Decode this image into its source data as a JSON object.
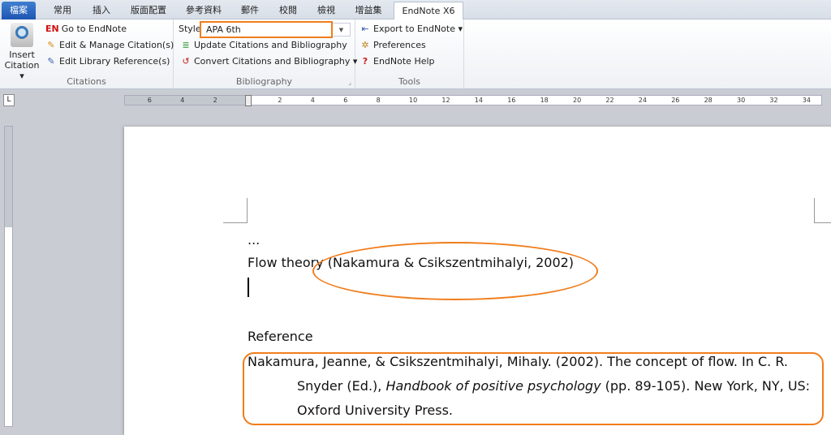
{
  "tabs": [
    "檔案",
    "常用",
    "插入",
    "版面配置",
    "參考資料",
    "郵件",
    "校閱",
    "檢視",
    "增益集",
    "EndNote X6"
  ],
  "ribbon": {
    "citations": {
      "insert_label1": "Insert",
      "insert_label2": "Citation",
      "go": "Go to EndNote",
      "edit_manage": "Edit & Manage Citation(s)",
      "edit_library": "Edit Library Reference(s)",
      "group": "Citations"
    },
    "bibliography": {
      "style_label": "Style:",
      "style_value": "APA 6th",
      "update": "Update Citations and Bibliography",
      "convert": "Convert Citations and Bibliography",
      "group": "Bibliography"
    },
    "tools": {
      "export": "Export to EndNote",
      "preferences": "Preferences",
      "help": "EndNote Help",
      "group": "Tools"
    },
    "en_logo": "EN"
  },
  "ruler": {
    "left": [
      "6",
      "4",
      "2"
    ],
    "right": [
      "2",
      "4",
      "6",
      "8",
      "10",
      "12",
      "14",
      "16",
      "18",
      "20",
      "22",
      "24",
      "26",
      "28",
      "30",
      "32",
      "34"
    ]
  },
  "document": {
    "ellipsis": "...",
    "line1_prefix": "Flow theory ",
    "citation": "(Nakamura & Csikszentmihalyi, 2002)",
    "heading": "Reference",
    "ref_line1": "Nakamura, Jeanne, & Csikszentmihalyi, Mihaly. (2002). The concept of flow. In C. R.",
    "ref_line2a": "Snyder (Ed.), ",
    "ref_line2_italic": "Handbook of positive psychology",
    "ref_line2b": " (pp. 89-105). New York, NY, US:",
    "ref_line3": "Oxford University Press."
  },
  "colors": {
    "highlight": "#f07d1c",
    "file_tab": "#2a64c0"
  }
}
